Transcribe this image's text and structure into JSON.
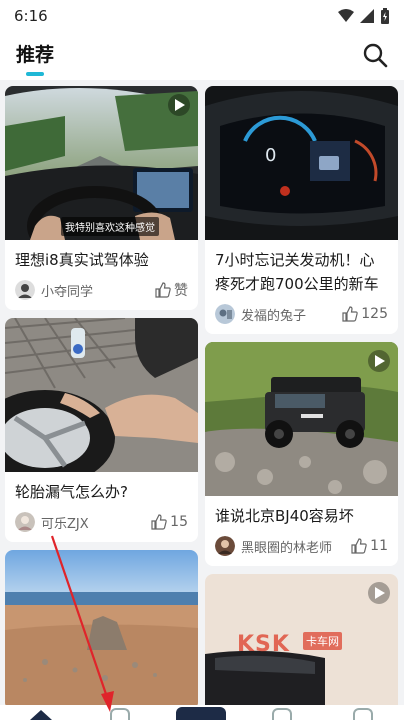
{
  "status_bar": {
    "time": "6:16"
  },
  "header": {
    "tab_label": "推荐",
    "accent_color": "#1fb8d6"
  },
  "feed": {
    "left_column": [
      {
        "title": "理想i8真实试驾体验",
        "author": "小夺同学",
        "like": "赞",
        "has_video": true,
        "caption": "我特别喜欢这种感觉"
      },
      {
        "title": "轮胎漏气怎么办?",
        "author": "可乐ZJX",
        "like": "15",
        "has_video": false
      },
      {
        "title": "",
        "author": "",
        "like": "",
        "has_video": false
      }
    ],
    "right_column": [
      {
        "title": "7小时忘记关发动机！心疼死才跑700公里的新车",
        "author": "发福的兔子",
        "like": "125",
        "has_video": false
      },
      {
        "title": "谁说北京BJ40容易坏",
        "author": "黑眼圈的林老师",
        "like": "11",
        "has_video": true
      },
      {
        "title": "",
        "author": "",
        "like": "",
        "has_video": true,
        "watermark": "KSK",
        "watermark_sub": "卡车网"
      }
    ]
  },
  "bottom_nav": {
    "center_color": "#1d2b46"
  }
}
